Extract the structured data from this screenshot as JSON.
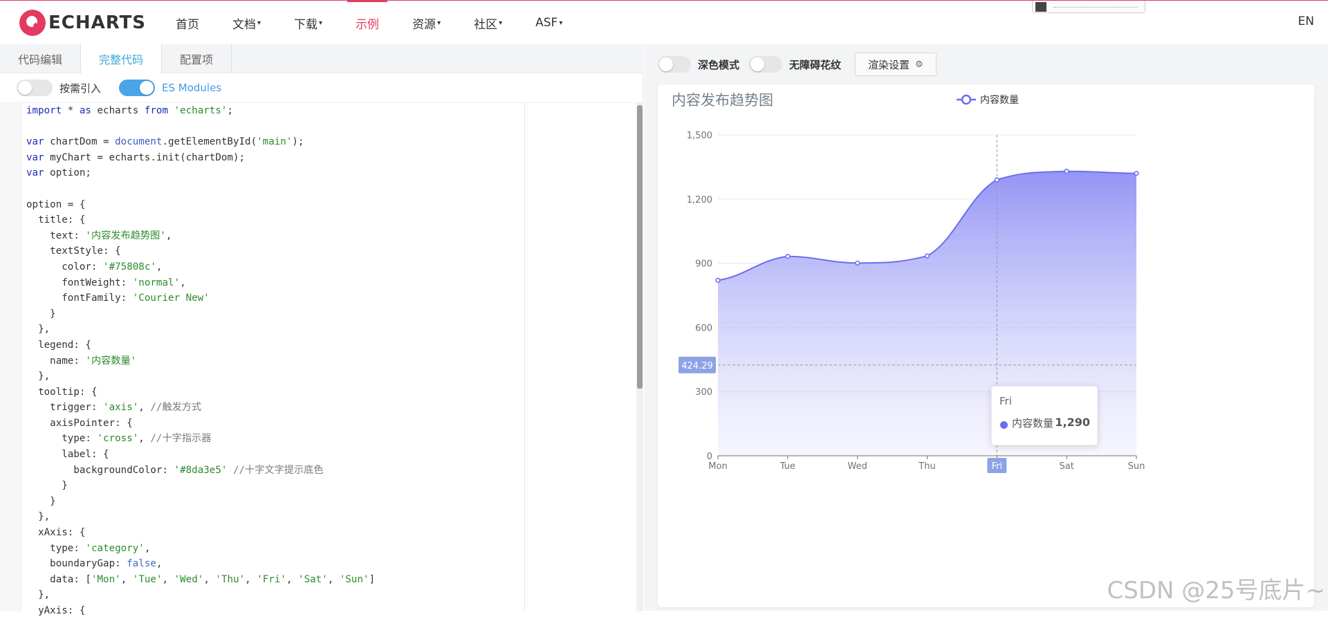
{
  "nav": {
    "logo_text": "ECHARTS",
    "items": [
      {
        "label": "首页",
        "caret": ""
      },
      {
        "label": "文档",
        "caret": "▾"
      },
      {
        "label": "下载",
        "caret": "▾"
      },
      {
        "label": "示例",
        "caret": ""
      },
      {
        "label": "资源",
        "caret": "▾"
      },
      {
        "label": "社区",
        "caret": "▾"
      },
      {
        "label": "ASF",
        "caret": "▾"
      }
    ],
    "active_index": 3,
    "lang": "EN",
    "accent_color": "#e43961"
  },
  "editor": {
    "tabs": [
      "代码编辑",
      "完整代码",
      "配置项"
    ],
    "active_tab": 1,
    "toggle_on_demand": {
      "label": "按需引入",
      "on": false
    },
    "toggle_es": {
      "label": "ES Modules",
      "on": true
    }
  },
  "preview": {
    "dark_mode_label": "深色模式",
    "decal_label": "无障碍花纹",
    "render_button_label": "渲染设置",
    "render_icon": "gear-icon"
  },
  "tooltip": {
    "category": "Fri",
    "series_name": "内容数量",
    "value": "1,290"
  },
  "crosshair_label": "424.29",
  "watermark": "CSDN @25号底片~",
  "chart_data": {
    "type": "area",
    "title": "内容发布趋势图",
    "title_color": "#75808c",
    "legend": [
      "内容数量"
    ],
    "legend_position": "top-center",
    "categories": [
      "Mon",
      "Tue",
      "Wed",
      "Thu",
      "Fri",
      "Sat",
      "Sun"
    ],
    "series": [
      {
        "name": "内容数量",
        "values": [
          820,
          932,
          901,
          934,
          1290,
          1330,
          1320
        ],
        "color": "#6c6cf0"
      }
    ],
    "smooth": true,
    "y_ticks": [
      "0",
      "300",
      "600",
      "900",
      "1,200",
      "1,500"
    ],
    "ylim": [
      0,
      1500
    ],
    "grid": true,
    "highlighted_category": "Fri",
    "highlight_color": "#8da3e5"
  }
}
